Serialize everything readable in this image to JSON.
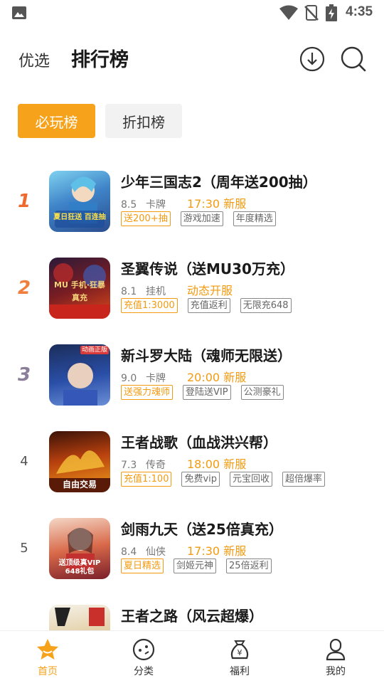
{
  "status_bar": {
    "time": "4:35"
  },
  "header": {
    "tab_featured": "优选",
    "tab_ranking": "排行榜"
  },
  "chips": {
    "must_play": "必玩榜",
    "discount": "折扣榜"
  },
  "games": [
    {
      "rank": "1",
      "name": "少年三国志2（周年送200抽）",
      "score": "8.5",
      "genre": "卡牌",
      "server": "17:30 新服",
      "tags": [
        "送200+抽",
        "游戏加速",
        "年度精选"
      ],
      "thumb_text": "夏日狂送 百连抽"
    },
    {
      "rank": "2",
      "name": "圣翼传说（送MU30万充）",
      "score": "8.1",
      "genre": "挂机",
      "server": "动态开服",
      "tags": [
        "充值1:3000",
        "充值返利",
        "无限充648"
      ],
      "thumb_text": "MU 手机·狂暴真充"
    },
    {
      "rank": "3",
      "name": "新斗罗大陆（魂师无限送）",
      "score": "9.0",
      "genre": "卡牌",
      "server": "20:00 新服",
      "tags": [
        "送强力魂师",
        "登陆送VIP",
        "公测豪礼"
      ],
      "thumb_text": "动画正版"
    },
    {
      "rank": "4",
      "name": "王者战歌（血战洪兴帮）",
      "score": "7.3",
      "genre": "传奇",
      "server": "18:00 新服",
      "tags": [
        "充值1:100",
        "免费vip",
        "元宝回收",
        "超倍爆率"
      ],
      "thumb_text": "自由交易"
    },
    {
      "rank": "5",
      "name": "剑雨九天（送25倍真充）",
      "score": "8.4",
      "genre": "仙侠",
      "server": "17:30 新服",
      "tags": [
        "夏日精选",
        "剑姬元神",
        "25倍返利"
      ],
      "thumb_text": "送顶级真VIP 648礼包"
    },
    {
      "rank": "",
      "name": "王者之路（风云超爆）"
    }
  ],
  "bottom_nav": {
    "home": "首页",
    "category": "分类",
    "welfare": "福利",
    "mine": "我的"
  },
  "colors": {
    "accent": "#f7a21b",
    "server_time": "#f39a10"
  }
}
